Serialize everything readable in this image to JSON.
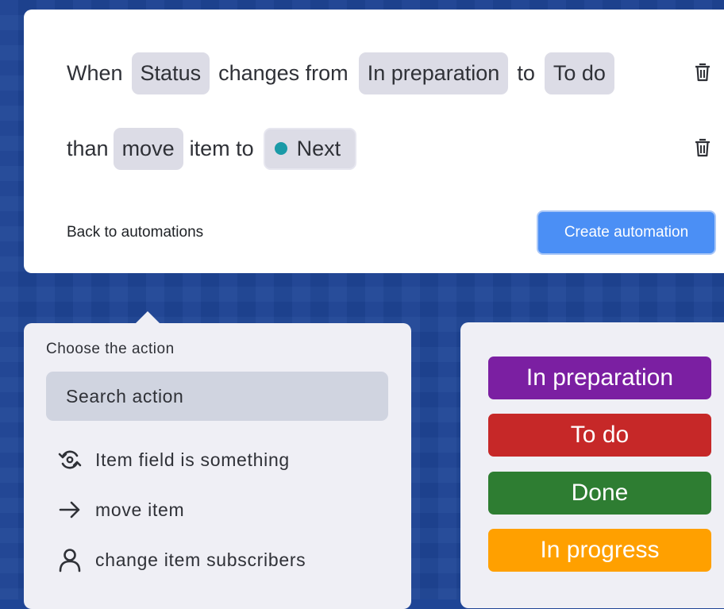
{
  "rule": {
    "when_label": "When",
    "field": "Status",
    "changes_label": "changes from",
    "from_value": "In preparation",
    "to_label": "to",
    "to_value": "To do",
    "than_label": "than",
    "action": "move",
    "item_to_label": "item to",
    "target": "Next",
    "target_dot_color": "#1a9aa7"
  },
  "footer": {
    "back_label": "Back to automations",
    "create_label": "Create automation",
    "accent_color": "#4b8ff5"
  },
  "action_panel": {
    "title": "Choose the action",
    "search_placeholder": "Search action",
    "items": [
      {
        "icon": "cycle-icon",
        "label": "Item field is something"
      },
      {
        "icon": "arrow-right-icon",
        "label": "move item"
      },
      {
        "icon": "person-icon",
        "label": "change item subscribers"
      }
    ]
  },
  "statuses": [
    {
      "label": "In preparation",
      "color": "#7b1fa2"
    },
    {
      "label": "To do",
      "color": "#c62828"
    },
    {
      "label": "Done",
      "color": "#2e7d32"
    },
    {
      "label": "In progress",
      "color": "#ffa000"
    }
  ]
}
